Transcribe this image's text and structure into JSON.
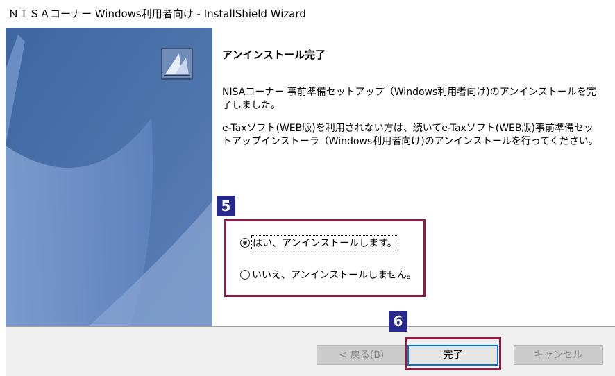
{
  "window": {
    "title": "ＮＩＳＡコーナー Windows利用者向け - InstallShield Wizard"
  },
  "content": {
    "heading": "アンインストール完了",
    "paragraph1": "NISAコーナー 事前準備セットアップ（Windows利用者向け)のアンインストールを完了しました。",
    "paragraph2": "e-Taxソフト(WEB版)を利用されない方は、続いてe-Taxソフト(WEB版)事前準備セットアップインストーラ（Windows利用者向け)のアンインストールを行ってください。"
  },
  "annotations": {
    "badge_options": "5",
    "badge_finish": "6",
    "highlight_color": "#8b1c46",
    "badge_color": "#27298c"
  },
  "options": {
    "yes_label": "はい、アンインストールします。",
    "no_label": "いいえ、アンインストールしません。",
    "selected": "yes"
  },
  "buttons": {
    "back_label": "< 戻る(B)",
    "finish_label": "完了",
    "cancel_label": "キャンセル"
  },
  "icons": {
    "wizard": "installshield-wizard-icon",
    "side_panel": "sail-graphic"
  }
}
